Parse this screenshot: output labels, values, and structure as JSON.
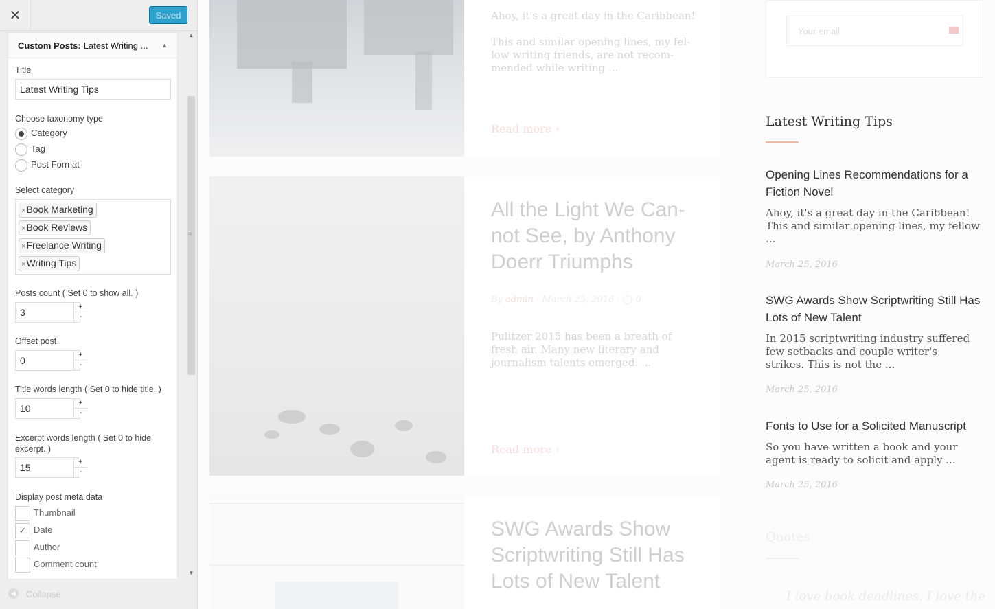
{
  "panel": {
    "close_icon": "close-icon",
    "saved_label": "Saved",
    "accent_color": "#2ea2cc",
    "widget_header": {
      "prefix": "Custom Posts:",
      "name": "Latest Writing ..."
    },
    "title_label": "Title",
    "title_value": "Latest Writing Tips",
    "taxonomy_label": "Choose taxonomy type",
    "taxonomy_options": [
      {
        "label": "Category",
        "selected": true
      },
      {
        "label": "Tag",
        "selected": false
      },
      {
        "label": "Post Format",
        "selected": false
      }
    ],
    "category_label": "Select category",
    "categories": [
      "Book Marketing",
      "Book Reviews",
      "Freelance Writing",
      "Writing Tips"
    ],
    "chip_remove": "×",
    "posts_count_label": "Posts count ( Set 0 to show all. )",
    "posts_count": "3",
    "offset_label": "Offset post",
    "offset": "0",
    "title_words_label": "Title words length ( Set 0 to hide title. )",
    "title_words": "10",
    "excerpt_words_label": "Excerpt words length ( Set 0 to hide excerpt. )",
    "excerpt_words": "15",
    "meta_label": "Display post meta data",
    "meta_options": [
      {
        "label": "Thumbnail",
        "checked": false
      },
      {
        "label": "Date",
        "checked": true
      },
      {
        "label": "Author",
        "checked": false
      },
      {
        "label": "Comment count",
        "checked": false
      }
    ],
    "spin_up": "+",
    "spin_down": "-",
    "check_mark": "✓",
    "collapse_label": "Collapse"
  },
  "preview": {
    "posts": [
      {
        "excerpt_lead": "Ahoy, it's a great day in the Caribbean!",
        "excerpt": "This and similar opening lines, my fel-low writing friends, are not recom-mended while writing ...",
        "read_more": "Read more"
      },
      {
        "title": "All the Light We Can-not See, by Anthony Doerr Triumphs",
        "meta_by": "By",
        "meta_author": "admin",
        "meta_date": "March 25, 2016",
        "meta_comments": "0",
        "excerpt": "Pulitzer 2015 has been a breath of fresh air. Many new literary and journalism talents emerged. ...",
        "read_more": "Read more"
      },
      {
        "title": "SWG Awards Show Scriptwriting Still Has Lots of New Talent"
      }
    ],
    "subscribe": {
      "email_placeholder": "Your email"
    },
    "sidebar": {
      "widget_title": "Latest Writing Tips",
      "items": [
        {
          "title": "Opening Lines Recommendations for a Fiction Novel",
          "excerpt": "Ahoy, it's a great day in the Caribbean! This and similar opening lines, my fellow ...",
          "date": "March 25, 2016"
        },
        {
          "title": "SWG Awards Show Scriptwriting Still Has Lots of New Talent",
          "excerpt": "In 2015 scriptwriting industry suffered few setbacks and couple writer's strikes. This is not the ...",
          "date": "March 25, 2016"
        },
        {
          "title": "Fonts to Use for a Solicited Manuscript",
          "excerpt": "So you have written a book and your agent is ready to solicit and apply ...",
          "date": "March 25, 2016"
        }
      ],
      "quotes_title": "Quotes",
      "quote_text": "I love book deadlines. I love the"
    }
  }
}
